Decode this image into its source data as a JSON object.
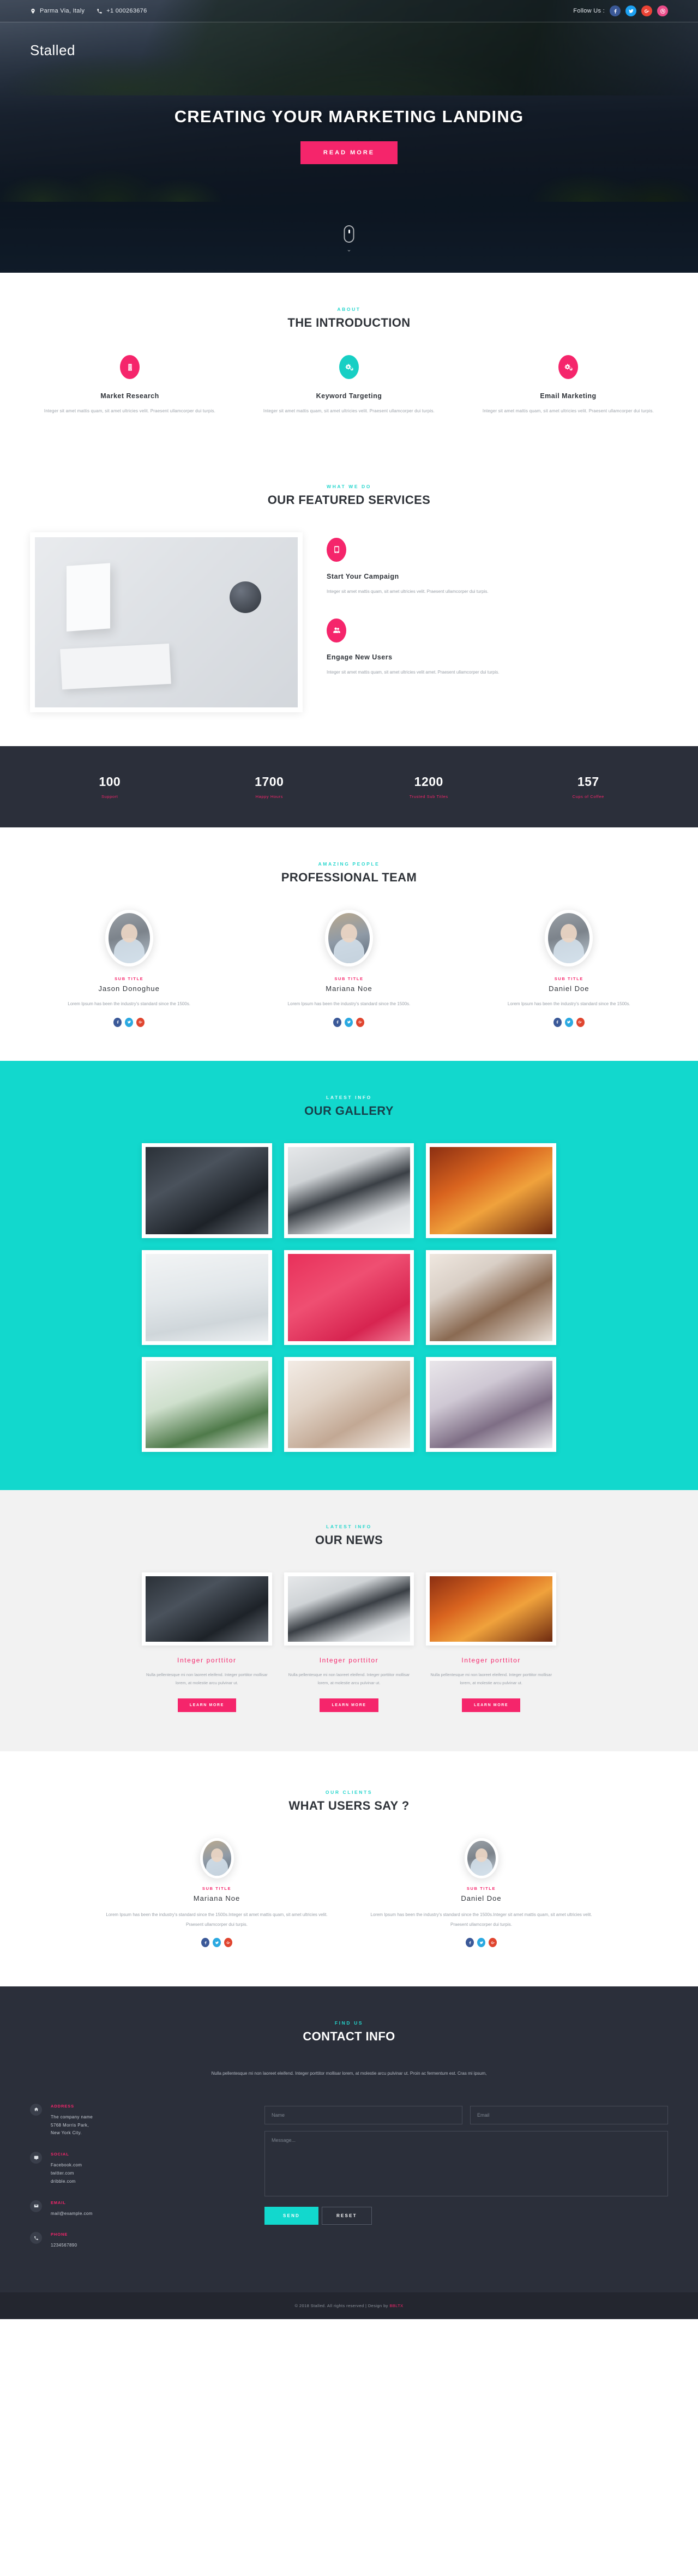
{
  "topbar": {
    "address": "Parma Via, Italy",
    "phone": "+1 000263676",
    "follow_label": "Follow Us :",
    "socials": [
      "facebook",
      "twitter",
      "google-plus",
      "dribbble"
    ]
  },
  "hero": {
    "brand": "Stalled",
    "title": "CREATING YOUR MARKETING LANDING",
    "cta": "READ MORE"
  },
  "intro": {
    "kicker": "ABOUT",
    "title": "THE INTRODUCTION",
    "cards": [
      {
        "icon": "building-icon",
        "color": "pink",
        "title": "Market Research",
        "text": "Integer sit amet mattis quam, sit amet ultricies velit. Praesent ullamcorper dui turpis."
      },
      {
        "icon": "cogs-icon",
        "color": "teal",
        "title": "Keyword Targeting",
        "text": "Integer sit amet mattis quam, sit amet ultricies velit. Praesent ullamcorper dui turpis."
      },
      {
        "icon": "cogs-icon",
        "color": "pink",
        "title": "Email Marketing",
        "text": "Integer sit amet mattis quam, sit amet ultricies velit. Praesent ullamcorper dui turpis."
      }
    ]
  },
  "services": {
    "kicker": "WHAT WE DO",
    "title": "OUR FEATURED SERVICES",
    "items": [
      {
        "icon": "mobile-icon",
        "title": "Start Your Campaign",
        "text": "Integer sit amet mattis quam, sit amet ultricies velit. Praesent ullamcorper dui turpis."
      },
      {
        "icon": "users-icon",
        "title": "Engage New Users",
        "text": "Integer sit amet mattis quam, sit amet ultricies velit amet. Praesent ullamcorper dui turpis."
      }
    ]
  },
  "counters": [
    {
      "number": "100",
      "label": "Support"
    },
    {
      "number": "1700",
      "label": "Happy Hours"
    },
    {
      "number": "1200",
      "label": "Trusted Sub Titles"
    },
    {
      "number": "157",
      "label": "Cups of Coffee"
    }
  ],
  "team": {
    "kicker": "AMAZING PEOPLE",
    "title": "PROFESSIONAL TEAM",
    "members": [
      {
        "sub": "SUB TITLE",
        "name": "Jason Donoghue",
        "text": "Lorem Ipsum has been the industry's standard since the 1500s."
      },
      {
        "sub": "SUB TITLE",
        "name": "Mariana Noe",
        "text": "Lorem Ipsum has been the industry's standard since the 1500s."
      },
      {
        "sub": "SUB TITLE",
        "name": "Daniel Doe",
        "text": "Lorem Ipsum has been the industry's standard since the 1500s."
      }
    ]
  },
  "gallery": {
    "kicker": "LATEST INFO",
    "title": "OUR GALLERY",
    "items": [
      "photo-umbrella-night",
      "photo-vintage-camera",
      "photo-orange-flower",
      "photo-minimal-bird",
      "photo-red-bicycle",
      "photo-flower-bowl",
      "photo-green-leaves",
      "photo-hands-watch",
      "photo-dried-bouquet"
    ]
  },
  "news": {
    "kicker": "LATEST INFO",
    "title": "OUR NEWS",
    "cards": [
      {
        "image": "photo-umbrella-night",
        "title": "Integer porttitor",
        "text": "Nulla pellentesque mi non laoreet eleifend. Integer porttitor mollisar lorem, at molestie arcu pulvinar ut.",
        "cta": "LEARN MORE"
      },
      {
        "image": "photo-vintage-camera",
        "title": "Integer porttitor",
        "text": "Nulla pellentesque mi non laoreet eleifend. Integer porttitor mollisar lorem, at molestie arcu pulvinar ut.",
        "cta": "LEARN MORE"
      },
      {
        "image": "photo-orange-flower",
        "title": "Integer porttitor",
        "text": "Nulla pellentesque mi non laoreet eleifend. Integer porttitor mollisar lorem, at molestie arcu pulvinar ut.",
        "cta": "LEARN MORE"
      }
    ]
  },
  "testimonials": {
    "kicker": "OUR CLIENTS",
    "title": "WHAT USERS SAY ?",
    "items": [
      {
        "sub": "SUB TITLE",
        "name": "Mariana Noe",
        "text": "Lorem Ipsum has been the industry's standard since the 1500s.Integer sit amet mattis quam, sit amet ultricies velit. Praesent ullamcorper dui turpis."
      },
      {
        "sub": "SUB TITLE",
        "name": "Daniel Doe",
        "text": "Lorem Ipsum has been the industry's standard since the 1500s.Integer sit amet mattis quam, sit amet ultricies velit. Praesent ullamcorper dui turpis."
      }
    ]
  },
  "contact": {
    "kicker": "FIND US",
    "title": "CONTACT INFO",
    "description": "Nulla pellentesque mi non laoreet eleifend. Integer porttitor mollisar lorem, at molestie arcu pulvinar ut. Proin ac fermentum est. Cras mi ipsum,",
    "info": [
      {
        "icon": "home-icon",
        "label": "ADDRESS",
        "lines": "The company name\n5768 Morris Park,\nNew York City."
      },
      {
        "icon": "comment-icon",
        "label": "SOCIAL",
        "lines": "Facebook.com\ntwitter.com\ndribble.com"
      },
      {
        "icon": "envelope-icon",
        "label": "EMAIL",
        "lines": "mail@example.com"
      },
      {
        "icon": "phone-icon",
        "label": "PHONE",
        "lines": "1234567890"
      }
    ],
    "form": {
      "name_placeholder": "Name",
      "email_placeholder": "Email",
      "message_placeholder": "Message...",
      "send_label": "SEND",
      "reset_label": "RESET"
    }
  },
  "footer": {
    "text": "© 2018 Stalled. All rights reserved | Design by ",
    "highlight": "BBLTX"
  },
  "colors": {
    "pink": "#f5256b",
    "teal": "#12d8cd",
    "dark": "#2b2f3a",
    "muted": "#9aa0a8"
  }
}
